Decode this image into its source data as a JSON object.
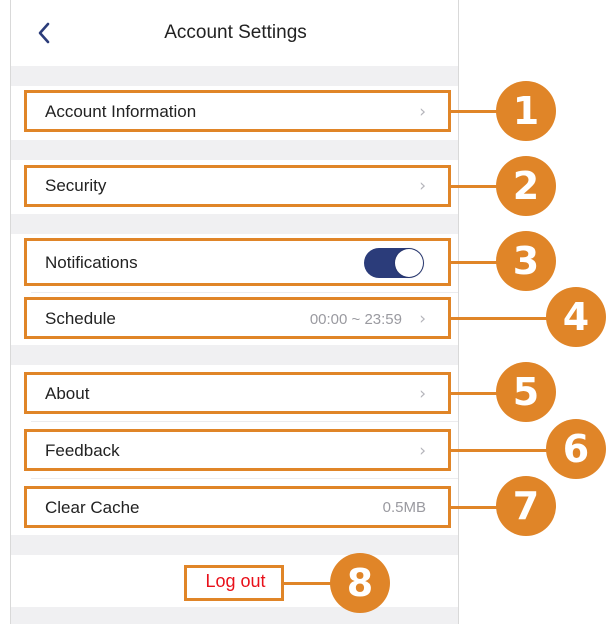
{
  "header": {
    "title": "Account Settings",
    "back_icon": "chevron-left-icon"
  },
  "rows": {
    "account_information": {
      "label": "Account Information",
      "chevron": "›"
    },
    "security": {
      "label": "Security",
      "chevron": "›"
    },
    "notifications": {
      "label": "Notifications",
      "toggle_on": true
    },
    "schedule": {
      "label": "Schedule",
      "value": "00:00 ~ 23:59",
      "chevron": "›"
    },
    "about": {
      "label": "About",
      "chevron": "›"
    },
    "feedback": {
      "label": "Feedback",
      "chevron": "›"
    },
    "clear_cache": {
      "label": "Clear Cache",
      "value": "0.5MB"
    }
  },
  "logout": {
    "label": "Log out"
  },
  "callouts": [
    "1",
    "2",
    "3",
    "4",
    "5",
    "6",
    "7",
    "8"
  ],
  "colors": {
    "accent_orange": "#e08528",
    "toggle_on": "#2b3c7a",
    "logout_red": "#e8101a",
    "gap_gray": "#f0f0f2"
  }
}
